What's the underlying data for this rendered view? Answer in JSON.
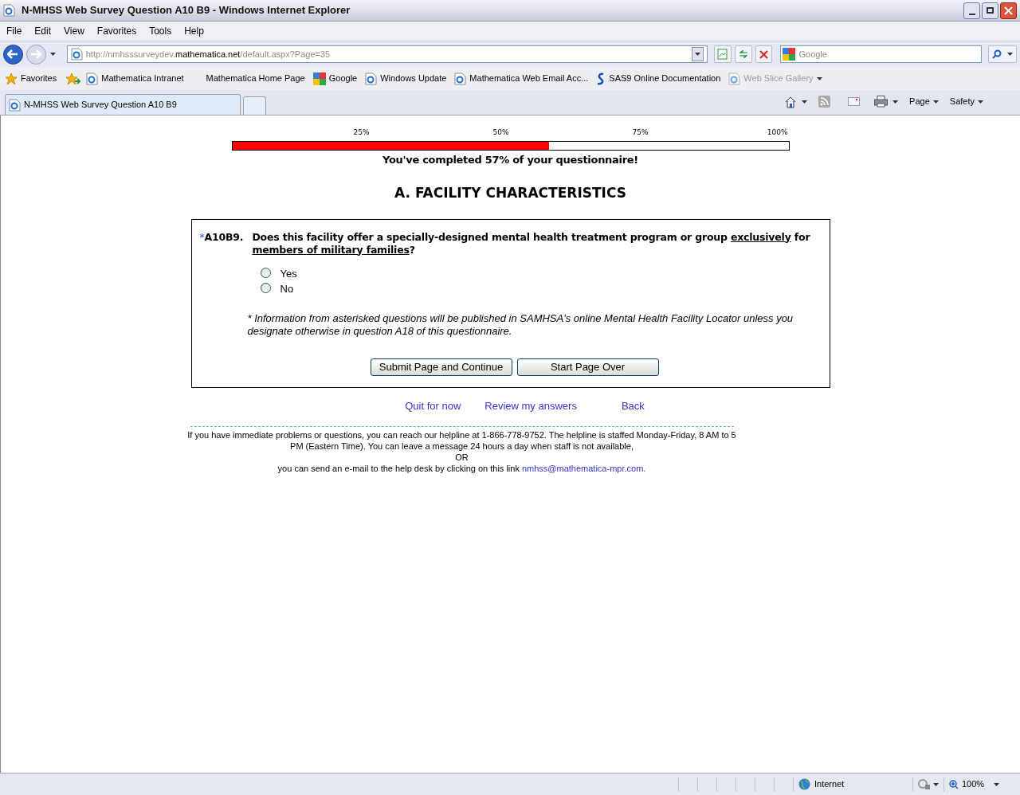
{
  "window": {
    "title": "N-MHSS Web Survey Question A10 B9 - Windows Internet Explorer"
  },
  "menu": [
    "File",
    "Edit",
    "View",
    "Favorites",
    "Tools",
    "Help"
  ],
  "address": {
    "prefix": "http://nmhsssurveydev.",
    "domain": "mathematica.net",
    "path": "/default.aspx?Page=35"
  },
  "search": {
    "placeholder": "Google"
  },
  "favorites_bar": {
    "label": "Favorites",
    "items": [
      {
        "label": "Mathematica Intranet",
        "kind": "ie",
        "disabled": false
      },
      {
        "label": "Mathematica Home Page",
        "kind": "plain",
        "disabled": false
      },
      {
        "label": "Google",
        "kind": "google",
        "disabled": false
      },
      {
        "label": "Windows Update",
        "kind": "ie",
        "disabled": false
      },
      {
        "label": "Mathematica Web Email Acc...",
        "kind": "ie",
        "disabled": false
      },
      {
        "label": "SAS9 Online Documentation",
        "kind": "sas",
        "disabled": false
      },
      {
        "label": "Web Slice Gallery",
        "kind": "ie",
        "disabled": true
      }
    ]
  },
  "tabs": [
    {
      "label": "N-MHSS Web Survey Question A10 B9",
      "selected": true
    }
  ],
  "command_bar": [
    "Page",
    "Safety"
  ],
  "progress": {
    "ticks": [
      "25%",
      "50%",
      "75%",
      "100%"
    ],
    "level": 0.57,
    "message": "You've completed 57% of your questionnaire!"
  },
  "section_title": "A. FACILITY CHARACTERISTICS",
  "question": {
    "marker": "*",
    "number": "A10B9.",
    "parts": [
      {
        "text": "Does this facility offer a specially-designed mental health treatment program or group ",
        "underlined": false
      },
      {
        "text": "exclusively",
        "underlined": true
      },
      {
        "text": " for ",
        "underlined": false
      },
      {
        "text": "members of military families",
        "underlined": true
      },
      {
        "text": "?",
        "underlined": false
      }
    ],
    "options": [
      {
        "label": "Yes",
        "selected": false
      },
      {
        "label": "No",
        "selected": false
      }
    ],
    "note": "* Information from asterisked questions will be published in SAMHSA's online Mental Health Facility Locator unless you designate otherwise in question A18 of this questionnaire.",
    "buttons": [
      "Submit Page and Continue",
      "Start Page Over"
    ]
  },
  "links": [
    "Quit for now",
    "Review my answers",
    "Back"
  ],
  "help": {
    "text": "If you have immediate problems or questions, you can reach our helpline at 1-866-778-9752. The helpline is staffed Monday-Friday, 8 AM to 5 PM (Eastern Time). You can leave a message 24 hours a day when staff is not available,",
    "or": "OR",
    "email_text": "you can send an e-mail to the help desk by clicking on this link",
    "email_link": "nmhss@mathematica-mpr.com."
  },
  "status_bar": {
    "zone": "Internet",
    "zoom": "100%"
  }
}
